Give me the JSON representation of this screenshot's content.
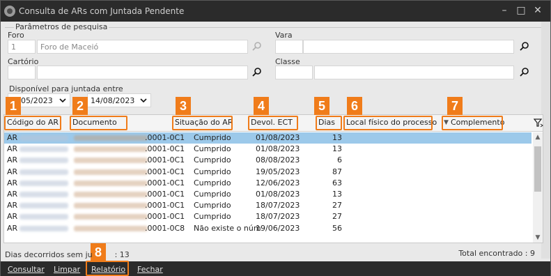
{
  "window": {
    "title": "Consulta de ARs com Juntada Pendente"
  },
  "filters": {
    "group_title": "Parâmetros de pesquisa",
    "foro": {
      "label": "Foro",
      "code": "1",
      "name": "Foro de Maceió"
    },
    "vara": {
      "label": "Vara",
      "code": "",
      "name": ""
    },
    "cartorio": {
      "label": "Cartório",
      "code": "",
      "name": ""
    },
    "classe": {
      "label": "Classe",
      "code": "",
      "name": ""
    },
    "date_range": {
      "label": "Disponível para juntada entre",
      "start": "05/2023",
      "end": "14/08/2023"
    }
  },
  "grid": {
    "columns": [
      "Código do AR",
      "Documento",
      "Situação do AR",
      "Devol. ECT",
      "Dias",
      "Local físico do processo",
      "Complemento"
    ],
    "sort_indicator": "▼",
    "badges": [
      "1",
      "2",
      "3",
      "4",
      "5",
      "6",
      "7",
      "8"
    ],
    "rows": [
      {
        "ar": "AR",
        "doc": ".0001-0C1",
        "situacao": "Cumprido",
        "devol": "01/08/2023",
        "dias": "13",
        "selected": true
      },
      {
        "ar": "AR",
        "doc": ".0001-0C1",
        "situacao": "Cumprido",
        "devol": "01/08/2023",
        "dias": "13",
        "selected": false
      },
      {
        "ar": "AR",
        "doc": ".0001-0C1",
        "situacao": "Cumprido",
        "devol": "08/08/2023",
        "dias": "6",
        "selected": false
      },
      {
        "ar": "AR",
        "doc": ".0001-0C1",
        "situacao": "Cumprido",
        "devol": "19/05/2023",
        "dias": "87",
        "selected": false
      },
      {
        "ar": "AR",
        "doc": ".0001-0C1",
        "situacao": "Cumprido",
        "devol": "12/06/2023",
        "dias": "63",
        "selected": false
      },
      {
        "ar": "AR",
        "doc": ".0001-0C1",
        "situacao": "Cumprido",
        "devol": "01/08/2023",
        "dias": "13",
        "selected": false
      },
      {
        "ar": "AR",
        "doc": ".0001-0C1",
        "situacao": "Cumprido",
        "devol": "18/07/2023",
        "dias": "27",
        "selected": false
      },
      {
        "ar": "AR",
        "doc": ".0001-0C1",
        "situacao": "Cumprido",
        "devol": "18/07/2023",
        "dias": "27",
        "selected": false
      },
      {
        "ar": "AR",
        "doc": ".0001-0C8",
        "situacao": "Não existe o núm",
        "devol": "19/06/2023",
        "dias": "56",
        "selected": false
      }
    ]
  },
  "status": {
    "left_prefix": "Dias decorridos sem ju",
    "left_suffix": ": 13",
    "right": "Total encontrado : 9"
  },
  "toolbar": {
    "consultar": "Consultar",
    "limpar": "Limpar",
    "relatorio": "Relatório",
    "fechar": "Fechar"
  },
  "colors": {
    "accent": "#f07c1a",
    "selection": "#9cc9ea",
    "titlebar": "#2b2b2b"
  },
  "icons": [
    "app-icon",
    "minimize-icon",
    "maximize-icon",
    "close-icon",
    "search-icon",
    "chevron-down-icon",
    "filter-icon"
  ]
}
